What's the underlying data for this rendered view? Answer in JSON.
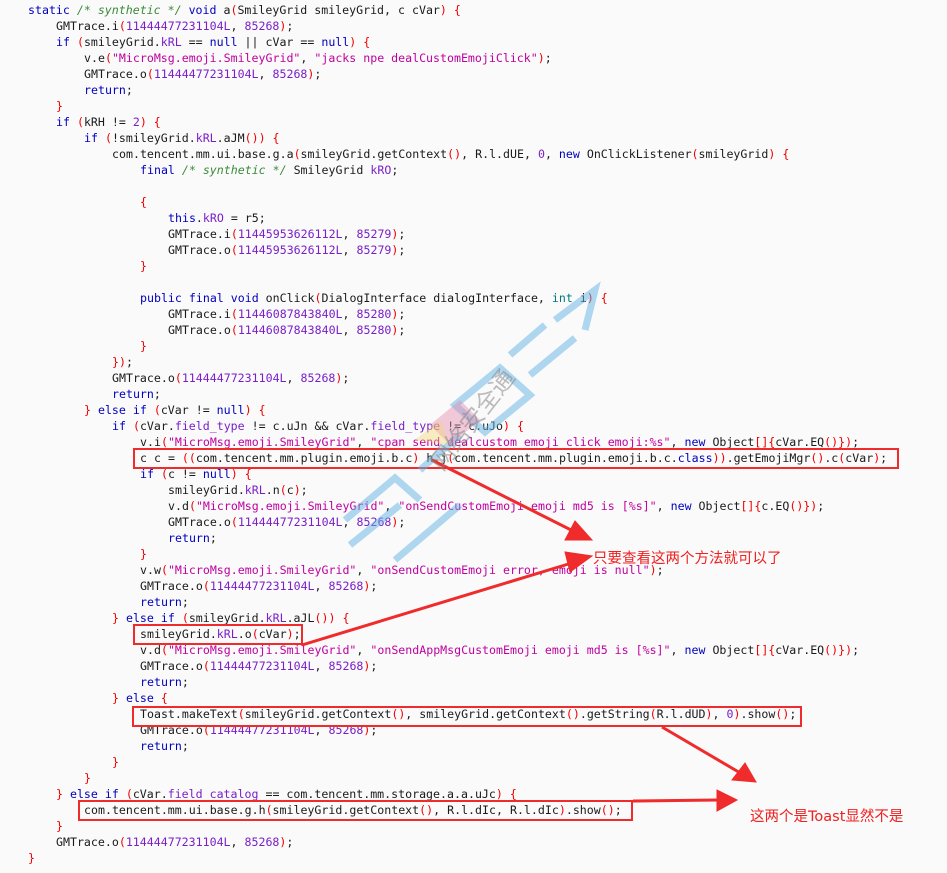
{
  "code": {
    "indent_unit": 4,
    "lines": [
      {
        "i": 0,
        "t": "static /* synthetic */ void a(SmileyGrid smileyGrid, c cVar) {"
      },
      {
        "i": 1,
        "t": "GMTrace.i(11444477231104L, 85268);"
      },
      {
        "i": 1,
        "t": "if (smileyGrid.kRL == null || cVar == null) {"
      },
      {
        "i": 2,
        "t": "v.e(\"MicroMsg.emoji.SmileyGrid\", \"jacks npe dealCustomEmojiClick\");"
      },
      {
        "i": 2,
        "t": "GMTrace.o(11444477231104L, 85268);"
      },
      {
        "i": 2,
        "t": "return;"
      },
      {
        "i": 1,
        "t": "}"
      },
      {
        "i": 1,
        "t": "if (kRH != 2) {"
      },
      {
        "i": 2,
        "t": "if (!smileyGrid.kRL.aJM()) {"
      },
      {
        "i": 3,
        "t": "com.tencent.mm.ui.base.g.a(smileyGrid.getContext(), R.l.dUE, 0, new OnClickListener(smileyGrid) {"
      },
      {
        "i": 4,
        "t": "final /* synthetic */ SmileyGrid kRO;"
      },
      {
        "i": 4,
        "t": ""
      },
      {
        "i": 4,
        "t": "{"
      },
      {
        "i": 5,
        "t": "this.kRO = r5;"
      },
      {
        "i": 5,
        "t": "GMTrace.i(11445953626112L, 85279);"
      },
      {
        "i": 5,
        "t": "GMTrace.o(11445953626112L, 85279);"
      },
      {
        "i": 4,
        "t": "}"
      },
      {
        "i": 4,
        "t": ""
      },
      {
        "i": 4,
        "t": "public final void onClick(DialogInterface dialogInterface, int i) {"
      },
      {
        "i": 5,
        "t": "GMTrace.i(11446087843840L, 85280);"
      },
      {
        "i": 5,
        "t": "GMTrace.o(11446087843840L, 85280);"
      },
      {
        "i": 4,
        "t": "}"
      },
      {
        "i": 3,
        "t": "});"
      },
      {
        "i": 3,
        "t": "GMTrace.o(11444477231104L, 85268);"
      },
      {
        "i": 3,
        "t": "return;"
      },
      {
        "i": 2,
        "t": "} else if (cVar != null) {"
      },
      {
        "i": 3,
        "t": "if (cVar.field_type != c.uJn && cVar.field_type != c.uJo) {"
      },
      {
        "i": 4,
        "t": "v.i(\"MicroMsg.emoji.SmileyGrid\", \"cpan send dealcustom emoji click emoji:%s\", new Object[]{cVar.EQ()});"
      },
      {
        "i": 4,
        "t": "c c = ((com.tencent.mm.plugin.emoji.b.c) h.j(com.tencent.mm.plugin.emoji.b.c.class)).getEmojiMgr().c(cVar);"
      },
      {
        "i": 4,
        "t": "if (c != null) {"
      },
      {
        "i": 5,
        "t": "smileyGrid.kRL.n(c);"
      },
      {
        "i": 5,
        "t": "v.d(\"MicroMsg.emoji.SmileyGrid\", \"onSendCustomEmoji emoji md5 is [%s]\", new Object[]{c.EQ()});"
      },
      {
        "i": 5,
        "t": "GMTrace.o(11444477231104L, 85268);"
      },
      {
        "i": 5,
        "t": "return;"
      },
      {
        "i": 4,
        "t": "}"
      },
      {
        "i": 4,
        "t": "v.w(\"MicroMsg.emoji.SmileyGrid\", \"onSendCustomEmoji error, emoji is null\");"
      },
      {
        "i": 4,
        "t": "GMTrace.o(11444477231104L, 85268);"
      },
      {
        "i": 4,
        "t": "return;"
      },
      {
        "i": 3,
        "t": "} else if (smileyGrid.kRL.aJL()) {"
      },
      {
        "i": 4,
        "t": "smileyGrid.kRL.o(cVar);"
      },
      {
        "i": 4,
        "t": "v.d(\"MicroMsg.emoji.SmileyGrid\", \"onSendAppMsgCustomEmoji emoji md5 is [%s]\", new Object[]{cVar.EQ()});"
      },
      {
        "i": 4,
        "t": "GMTrace.o(11444477231104L, 85268);"
      },
      {
        "i": 4,
        "t": "return;"
      },
      {
        "i": 3,
        "t": "} else {"
      },
      {
        "i": 4,
        "t": "Toast.makeText(smileyGrid.getContext(), smileyGrid.getContext().getString(R.l.dUD), 0).show();"
      },
      {
        "i": 4,
        "t": "GMTrace.o(11444477231104L, 85268);"
      },
      {
        "i": 4,
        "t": "return;"
      },
      {
        "i": 3,
        "t": "}"
      },
      {
        "i": 2,
        "t": "}"
      },
      {
        "i": 1,
        "t": "} else if (cVar.field_catalog == com.tencent.mm.storage.a.a.uJc) {"
      },
      {
        "i": 2,
        "t": "com.tencent.mm.ui.base.g.h(smileyGrid.getContext(), R.l.dIc, R.l.dIc).show();"
      },
      {
        "i": 1,
        "t": "}"
      },
      {
        "i": 1,
        "t": "GMTrace.o(11444477231104L, 85268);"
      },
      {
        "i": 0,
        "t": "}"
      }
    ]
  },
  "annotations": {
    "note_methods": "只要查看这两个方法就可以了",
    "note_toast": "这两个是Toast显然不是",
    "color": "#ef2b2b"
  },
  "watermark": {
    "text": "网络安全通"
  }
}
